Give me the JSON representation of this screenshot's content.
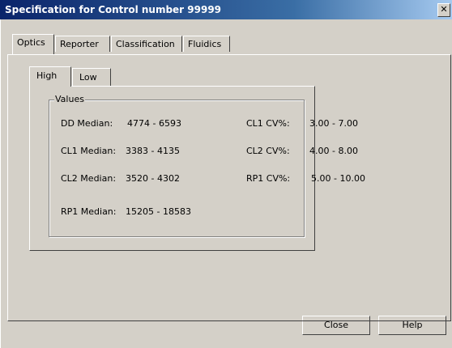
{
  "window": {
    "title": "Specification for Control number 99999",
    "close_glyph": "✕"
  },
  "tabs": [
    {
      "label": "Optics",
      "selected": true
    },
    {
      "label": "Reporter",
      "selected": false
    },
    {
      "label": "Classification",
      "selected": false
    },
    {
      "label": "Fluidics",
      "selected": false
    }
  ],
  "subtabs": [
    {
      "label": "High",
      "selected": true
    },
    {
      "label": "Low",
      "selected": false
    }
  ],
  "values_group": {
    "label": "Values",
    "left": [
      {
        "label": "DD Median:",
        "value": "4774 - 6593"
      },
      {
        "label": "CL1 Median:",
        "value": "3383 - 4135"
      },
      {
        "label": "CL2 Median:",
        "value": "3520 - 4302"
      },
      {
        "label": "RP1 Median:",
        "value": "15205 - 18583"
      }
    ],
    "right": [
      {
        "label": "CL1 CV%:",
        "value": "3.00 - 7.00"
      },
      {
        "label": "CL2 CV%:",
        "value": "4.00 - 8.00"
      },
      {
        "label": "RP1 CV%:",
        "value": "5.00 - 10.00"
      }
    ]
  },
  "buttons": {
    "close": "Close",
    "help": "Help"
  }
}
